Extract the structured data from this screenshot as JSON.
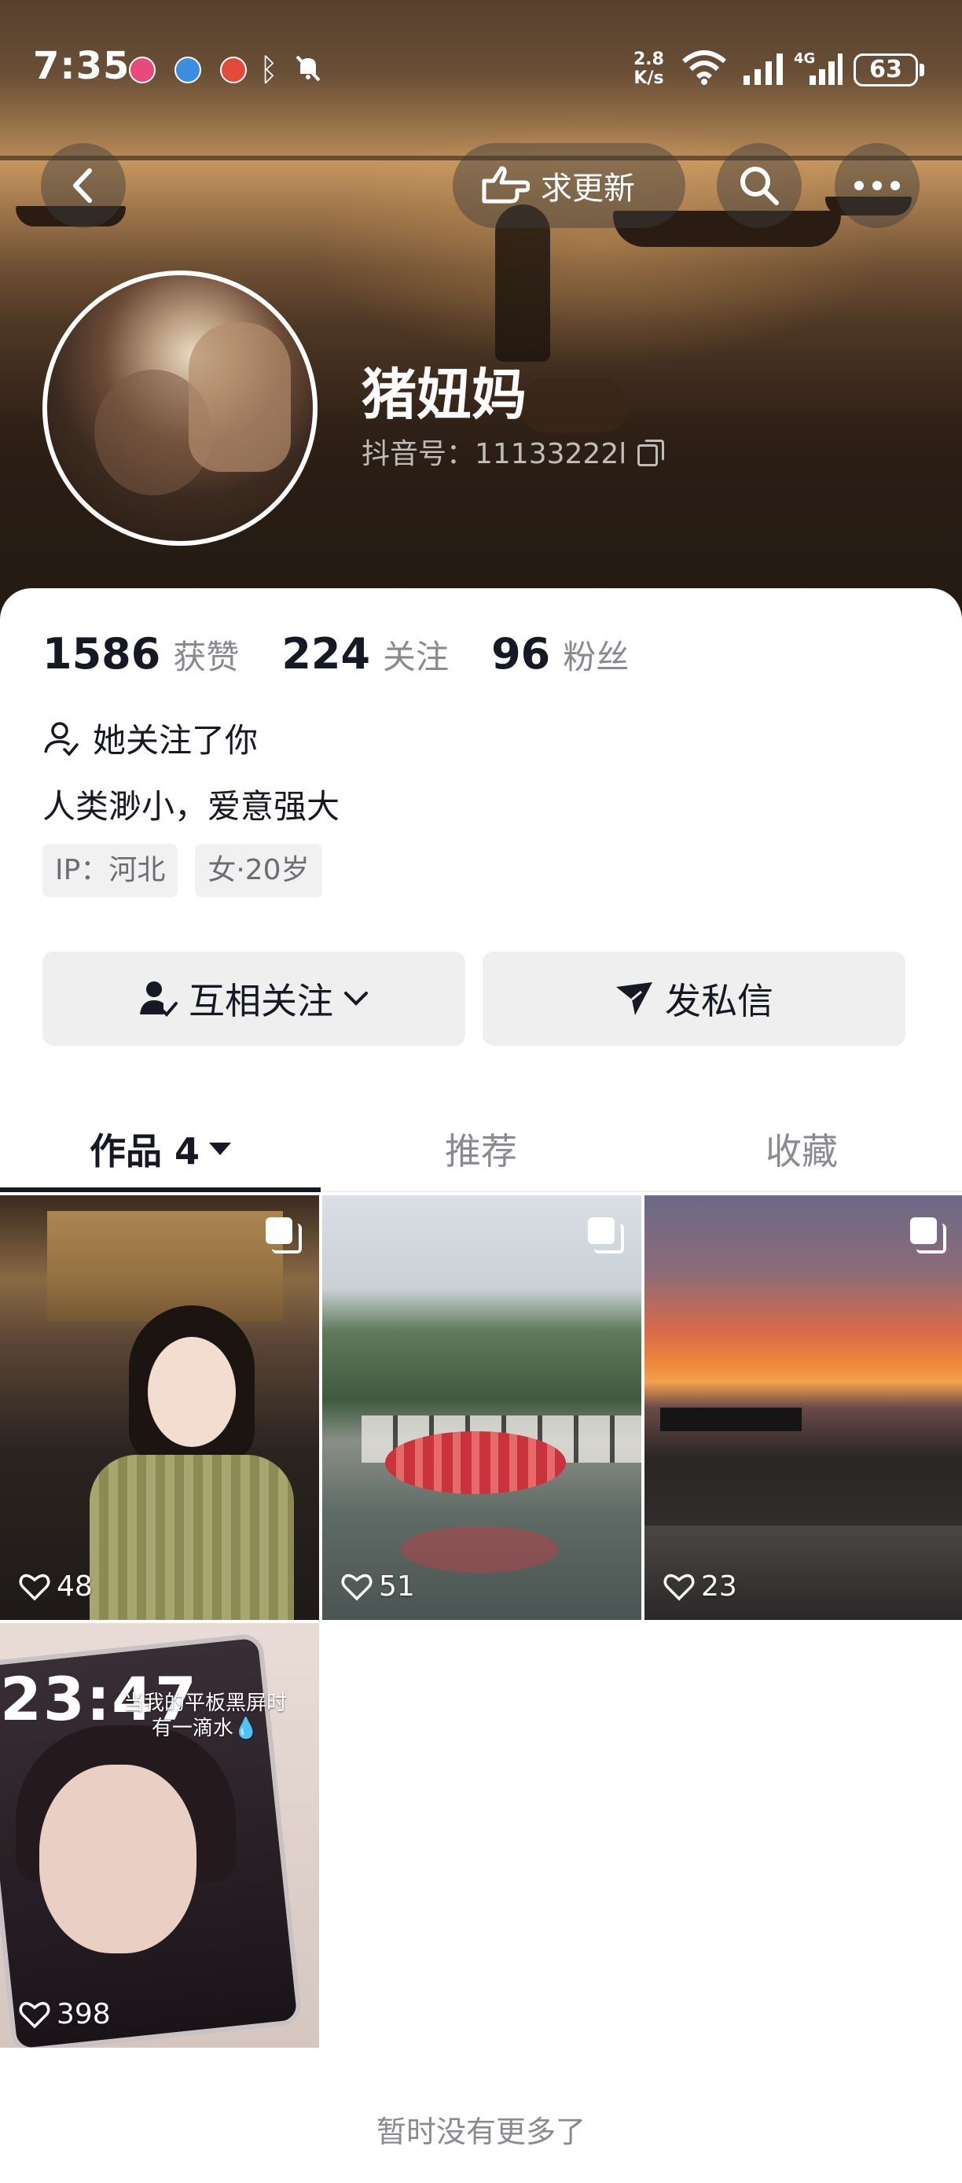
{
  "status_bar": {
    "time": "7:35",
    "net_speed_value": "2.8",
    "net_speed_unit": "K/s",
    "network_type": "4G",
    "battery": "63"
  },
  "nav": {
    "update_label": "求更新"
  },
  "profile": {
    "username": "猪妞妈",
    "douyin_id": "抖音号：11133222l"
  },
  "stats": [
    {
      "num": "1586",
      "label": "获赞"
    },
    {
      "num": "224",
      "label": "关注"
    },
    {
      "num": "96",
      "label": "粉丝"
    }
  ],
  "follows_you": "她关注了你",
  "bio": "人类渺小，爱意强大",
  "tags": [
    "IP：河北",
    "女·20岁"
  ],
  "actions": {
    "follow_label": "互相关注",
    "message_label": "发私信"
  },
  "tabs": [
    {
      "label": "作品 4",
      "active": true
    },
    {
      "label": "推荐",
      "active": false
    },
    {
      "label": "收藏",
      "active": false
    }
  ],
  "videos": [
    {
      "likes": "48"
    },
    {
      "likes": "51"
    },
    {
      "likes": "23"
    },
    {
      "likes": "398",
      "overlay_time": "23:47",
      "overlay_caption": "当我的平板黑屏时\n有一滴水💧"
    }
  ],
  "footer_text": "暂时没有更多了"
}
